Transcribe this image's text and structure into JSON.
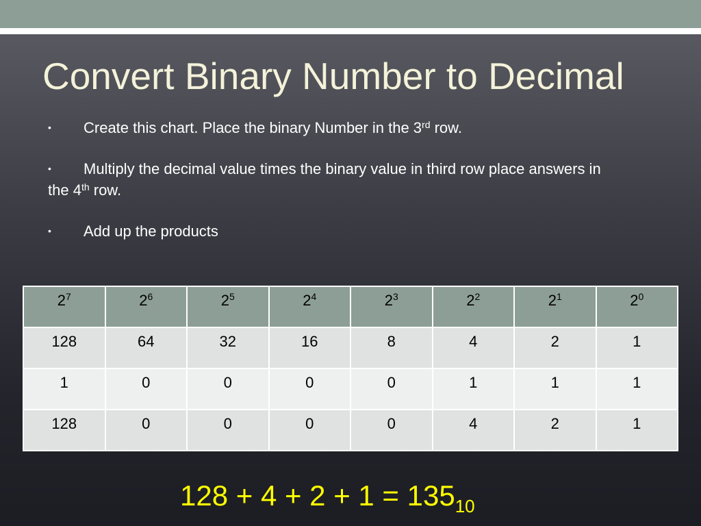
{
  "slide": {
    "title": "Convert Binary Number to Decimal",
    "bullet_glyph": "•",
    "bullets": [
      {
        "before": "Create this chart.  Place the binary Number in the 3",
        "sup": "rd",
        "after": " row."
      },
      {
        "before": "Multiply the decimal value times the binary value in third row place answers in the 4",
        "sup": "th",
        "after": " row."
      },
      {
        "before": "Add up the products",
        "sup": "",
        "after": ""
      }
    ]
  },
  "table": {
    "header": [
      {
        "base": "2",
        "exp": "7"
      },
      {
        "base": "2",
        "exp": "6"
      },
      {
        "base": "2",
        "exp": "5"
      },
      {
        "base": "2",
        "exp": "4"
      },
      {
        "base": "2",
        "exp": "3"
      },
      {
        "base": "2",
        "exp": "2"
      },
      {
        "base": "2",
        "exp": "1"
      },
      {
        "base": "2",
        "exp": "0"
      }
    ],
    "rows": [
      [
        "128",
        "64",
        "32",
        "16",
        "8",
        "4",
        "2",
        "1"
      ],
      [
        "1",
        "0",
        "0",
        "0",
        "0",
        "1",
        "1",
        "1"
      ],
      [
        "128",
        "0",
        "0",
        "0",
        "0",
        "4",
        "2",
        "1"
      ]
    ]
  },
  "result": {
    "expression": "128 + 4 + 2 + 1  = 135",
    "subscript": "10"
  },
  "colors": {
    "header_fill": "#8d9e97",
    "title_color": "#f4f2d9",
    "result_color": "#ffff00"
  }
}
